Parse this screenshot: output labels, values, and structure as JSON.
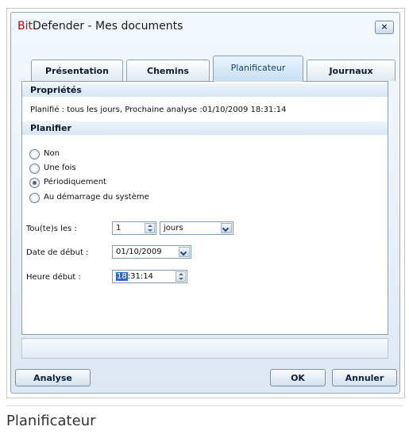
{
  "window": {
    "title_brand_a": "Bit",
    "title_brand_b": "Defender",
    "title_rest": " - Mes documents",
    "close_glyph": "×"
  },
  "tabs": [
    {
      "label": "Présentation",
      "active": false
    },
    {
      "label": "Chemins",
      "active": false
    },
    {
      "label": "Planificateur",
      "active": true
    },
    {
      "label": "Journaux",
      "active": false
    }
  ],
  "properties": {
    "heading": "Propriétés",
    "text": "Planifié : tous les jours, Prochaine analyse :01/10/2009 18:31:14"
  },
  "schedule": {
    "heading": "Planifier",
    "options": [
      {
        "label": "Non",
        "checked": false
      },
      {
        "label": "Une fois",
        "checked": false
      },
      {
        "label": "Périodiquement",
        "checked": true
      },
      {
        "label": "Au démarrage du système",
        "checked": false
      }
    ],
    "every_label": "Tou(te)s les :",
    "every_value": "1",
    "every_unit": "jours",
    "start_date_label": "Date de début :",
    "start_date_value": "01/10/2009",
    "start_time_label": "Heure début :",
    "start_time_hour": "18",
    "start_time_rest": ":31:14"
  },
  "buttons": {
    "analyse": "Analyse",
    "ok": "OK",
    "cancel": "Annuler"
  },
  "caption": "Planificateur",
  "colors": {
    "brand_red": "#d20000",
    "accent_blue": "#316ac5"
  }
}
